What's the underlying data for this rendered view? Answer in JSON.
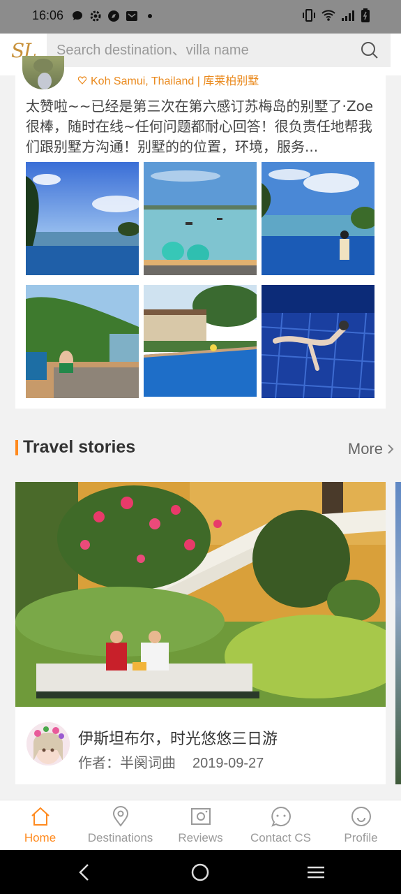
{
  "status_bar": {
    "time": "16:06",
    "left_icons": [
      "message-icon",
      "settings-icon",
      "compass-icon",
      "mail-icon",
      "dot-icon"
    ],
    "right_icons": [
      "vibrate-icon",
      "wifi-icon",
      "signal-icon",
      "battery-icon"
    ]
  },
  "header": {
    "logo": "SL",
    "search_placeholder": "Search destination、villa name"
  },
  "review": {
    "location": "Koh Samui, Thailand | 库莱柏别墅",
    "text": "太赞啦~~已经是第三次在第六感订苏梅岛的别墅了·Zoe很棒，随时在线~任何问题都耐心回答！很负责任地帮我们跟别墅方沟通！别墅的的位置，环境，服务...",
    "photos": [
      "infinity-pool-sea",
      "beach-drinks",
      "pool-girl",
      "terrace-woman",
      "villa-pool",
      "underwater-swimmer"
    ]
  },
  "travel_stories": {
    "title": "Travel stories",
    "more_label": "More",
    "story": {
      "title": "伊斯坦布尔，时光悠悠三日游",
      "author_label": "作者：半阕词曲",
      "date": "2019-09-27"
    }
  },
  "tabs": [
    {
      "label": "Home",
      "icon": "home-icon",
      "active": true
    },
    {
      "label": "Destinations",
      "icon": "location-pin-icon",
      "active": false
    },
    {
      "label": "Reviews",
      "icon": "camera-icon",
      "active": false
    },
    {
      "label": "Contact CS",
      "icon": "chat-bubble-icon",
      "active": false
    },
    {
      "label": "Profile",
      "icon": "profile-icon",
      "active": false
    }
  ],
  "colors": {
    "accent": "#ff8a1e",
    "logo": "#c8913a",
    "status_bar": "#8c8c8c",
    "inactive_tab": "#9a9a9a"
  }
}
